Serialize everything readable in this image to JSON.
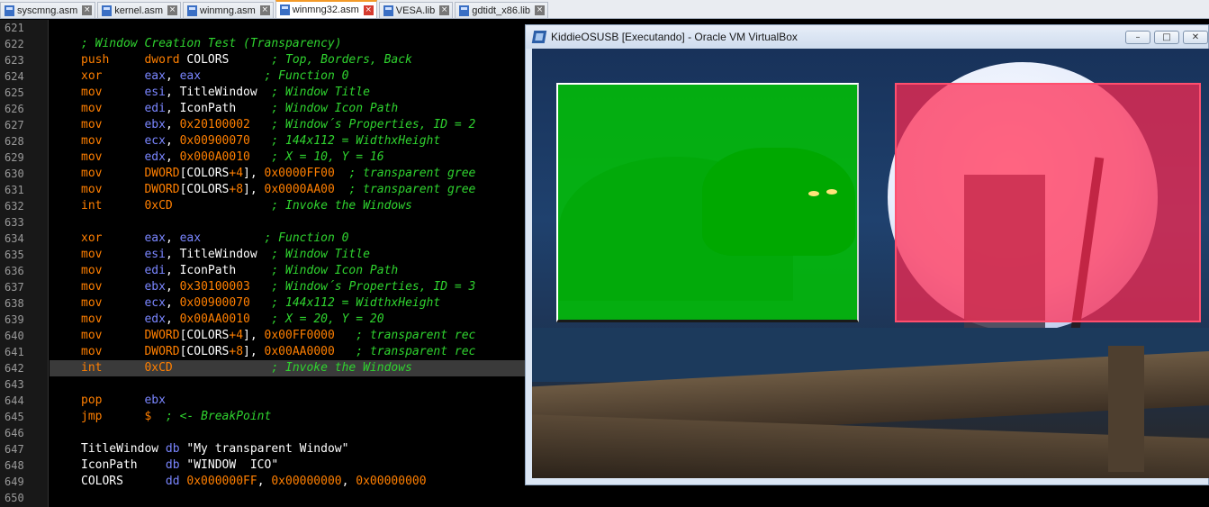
{
  "tabs": [
    {
      "label": "syscmng.asm",
      "active": false
    },
    {
      "label": "kernel.asm",
      "active": false
    },
    {
      "label": "winmng.asm",
      "active": false
    },
    {
      "label": "winmng32.asm",
      "active": true
    },
    {
      "label": "VESA.lib",
      "active": false
    },
    {
      "label": "gdtidt_x86.lib",
      "active": false
    }
  ],
  "editor": {
    "highlighted_line": "642",
    "lines": [
      {
        "n": "621",
        "tokens": []
      },
      {
        "n": "622",
        "tokens": [
          {
            "t": "; Window Creation Test (Transparency)",
            "c": "cmt"
          }
        ]
      },
      {
        "n": "623",
        "tokens": [
          {
            "t": "push",
            "c": "kw"
          },
          {
            "t": "     ",
            "c": "id"
          },
          {
            "t": "dword",
            "c": "kw"
          },
          {
            "t": " COLORS      ",
            "c": "id"
          },
          {
            "t": "; Top, Borders, Back",
            "c": "cmt"
          }
        ]
      },
      {
        "n": "624",
        "tokens": [
          {
            "t": "xor",
            "c": "kw"
          },
          {
            "t": "      ",
            "c": "id"
          },
          {
            "t": "eax",
            "c": "reg"
          },
          {
            "t": ", ",
            "c": "id"
          },
          {
            "t": "eax",
            "c": "reg"
          },
          {
            "t": "         ",
            "c": "id"
          },
          {
            "t": "; Function 0",
            "c": "cmt"
          }
        ]
      },
      {
        "n": "625",
        "tokens": [
          {
            "t": "mov",
            "c": "kw"
          },
          {
            "t": "      ",
            "c": "id"
          },
          {
            "t": "esi",
            "c": "reg"
          },
          {
            "t": ", TitleWindow  ",
            "c": "id"
          },
          {
            "t": "; Window Title",
            "c": "cmt"
          }
        ]
      },
      {
        "n": "626",
        "tokens": [
          {
            "t": "mov",
            "c": "kw"
          },
          {
            "t": "      ",
            "c": "id"
          },
          {
            "t": "edi",
            "c": "reg"
          },
          {
            "t": ", IconPath     ",
            "c": "id"
          },
          {
            "t": "; Window Icon Path",
            "c": "cmt"
          }
        ]
      },
      {
        "n": "627",
        "tokens": [
          {
            "t": "mov",
            "c": "kw"
          },
          {
            "t": "      ",
            "c": "id"
          },
          {
            "t": "ebx",
            "c": "reg"
          },
          {
            "t": ", ",
            "c": "id"
          },
          {
            "t": "0x20100002",
            "c": "num"
          },
          {
            "t": "   ",
            "c": "id"
          },
          {
            "t": "; Window´s Properties, ID = 2",
            "c": "cmt"
          }
        ]
      },
      {
        "n": "628",
        "tokens": [
          {
            "t": "mov",
            "c": "kw"
          },
          {
            "t": "      ",
            "c": "id"
          },
          {
            "t": "ecx",
            "c": "reg"
          },
          {
            "t": ", ",
            "c": "id"
          },
          {
            "t": "0x00900070",
            "c": "num"
          },
          {
            "t": "   ",
            "c": "id"
          },
          {
            "t": "; 144x112 = WidthxHeight",
            "c": "cmt"
          }
        ]
      },
      {
        "n": "629",
        "tokens": [
          {
            "t": "mov",
            "c": "kw"
          },
          {
            "t": "      ",
            "c": "id"
          },
          {
            "t": "edx",
            "c": "reg"
          },
          {
            "t": ", ",
            "c": "id"
          },
          {
            "t": "0x000A0010",
            "c": "num"
          },
          {
            "t": "   ",
            "c": "id"
          },
          {
            "t": "; X = 10, Y = 16",
            "c": "cmt"
          }
        ]
      },
      {
        "n": "630",
        "tokens": [
          {
            "t": "mov",
            "c": "kw"
          },
          {
            "t": "      ",
            "c": "id"
          },
          {
            "t": "DWORD",
            "c": "kw"
          },
          {
            "t": "[COLORS",
            "c": "id"
          },
          {
            "t": "+4",
            "c": "sym"
          },
          {
            "t": "], ",
            "c": "id"
          },
          {
            "t": "0x0000FF00",
            "c": "num"
          },
          {
            "t": "  ",
            "c": "id"
          },
          {
            "t": "; transparent gree",
            "c": "cmt"
          }
        ]
      },
      {
        "n": "631",
        "tokens": [
          {
            "t": "mov",
            "c": "kw"
          },
          {
            "t": "      ",
            "c": "id"
          },
          {
            "t": "DWORD",
            "c": "kw"
          },
          {
            "t": "[COLORS",
            "c": "id"
          },
          {
            "t": "+8",
            "c": "sym"
          },
          {
            "t": "], ",
            "c": "id"
          },
          {
            "t": "0x0000AA00",
            "c": "num"
          },
          {
            "t": "  ",
            "c": "id"
          },
          {
            "t": "; transparent gree",
            "c": "cmt"
          }
        ]
      },
      {
        "n": "632",
        "tokens": [
          {
            "t": "int",
            "c": "kw"
          },
          {
            "t": "      ",
            "c": "id"
          },
          {
            "t": "0xCD",
            "c": "num"
          },
          {
            "t": "              ",
            "c": "id"
          },
          {
            "t": "; Invoke the Windows",
            "c": "cmt"
          }
        ]
      },
      {
        "n": "633",
        "tokens": []
      },
      {
        "n": "634",
        "tokens": [
          {
            "t": "xor",
            "c": "kw"
          },
          {
            "t": "      ",
            "c": "id"
          },
          {
            "t": "eax",
            "c": "reg"
          },
          {
            "t": ", ",
            "c": "id"
          },
          {
            "t": "eax",
            "c": "reg"
          },
          {
            "t": "         ",
            "c": "id"
          },
          {
            "t": "; Function 0",
            "c": "cmt"
          }
        ]
      },
      {
        "n": "635",
        "tokens": [
          {
            "t": "mov",
            "c": "kw"
          },
          {
            "t": "      ",
            "c": "id"
          },
          {
            "t": "esi",
            "c": "reg"
          },
          {
            "t": ", TitleWindow  ",
            "c": "id"
          },
          {
            "t": "; Window Title",
            "c": "cmt"
          }
        ]
      },
      {
        "n": "636",
        "tokens": [
          {
            "t": "mov",
            "c": "kw"
          },
          {
            "t": "      ",
            "c": "id"
          },
          {
            "t": "edi",
            "c": "reg"
          },
          {
            "t": ", IconPath     ",
            "c": "id"
          },
          {
            "t": "; Window Icon Path",
            "c": "cmt"
          }
        ]
      },
      {
        "n": "637",
        "tokens": [
          {
            "t": "mov",
            "c": "kw"
          },
          {
            "t": "      ",
            "c": "id"
          },
          {
            "t": "ebx",
            "c": "reg"
          },
          {
            "t": ", ",
            "c": "id"
          },
          {
            "t": "0x30100003",
            "c": "num"
          },
          {
            "t": "   ",
            "c": "id"
          },
          {
            "t": "; Window´s Properties, ID = 3",
            "c": "cmt"
          }
        ]
      },
      {
        "n": "638",
        "tokens": [
          {
            "t": "mov",
            "c": "kw"
          },
          {
            "t": "      ",
            "c": "id"
          },
          {
            "t": "ecx",
            "c": "reg"
          },
          {
            "t": ", ",
            "c": "id"
          },
          {
            "t": "0x00900070",
            "c": "num"
          },
          {
            "t": "   ",
            "c": "id"
          },
          {
            "t": "; 144x112 = WidthxHeight",
            "c": "cmt"
          }
        ]
      },
      {
        "n": "639",
        "tokens": [
          {
            "t": "mov",
            "c": "kw"
          },
          {
            "t": "      ",
            "c": "id"
          },
          {
            "t": "edx",
            "c": "reg"
          },
          {
            "t": ", ",
            "c": "id"
          },
          {
            "t": "0x00AA0010",
            "c": "num"
          },
          {
            "t": "   ",
            "c": "id"
          },
          {
            "t": "; X = 20, Y = 20",
            "c": "cmt"
          }
        ]
      },
      {
        "n": "640",
        "tokens": [
          {
            "t": "mov",
            "c": "kw"
          },
          {
            "t": "      ",
            "c": "id"
          },
          {
            "t": "DWORD",
            "c": "kw"
          },
          {
            "t": "[COLORS",
            "c": "id"
          },
          {
            "t": "+4",
            "c": "sym"
          },
          {
            "t": "], ",
            "c": "id"
          },
          {
            "t": "0x00FF0000",
            "c": "num"
          },
          {
            "t": "   ",
            "c": "id"
          },
          {
            "t": "; transparent rec",
            "c": "cmt"
          }
        ]
      },
      {
        "n": "641",
        "tokens": [
          {
            "t": "mov",
            "c": "kw"
          },
          {
            "t": "      ",
            "c": "id"
          },
          {
            "t": "DWORD",
            "c": "kw"
          },
          {
            "t": "[COLORS",
            "c": "id"
          },
          {
            "t": "+8",
            "c": "sym"
          },
          {
            "t": "], ",
            "c": "id"
          },
          {
            "t": "0x00AA0000",
            "c": "num"
          },
          {
            "t": "   ",
            "c": "id"
          },
          {
            "t": "; transparent rec",
            "c": "cmt"
          }
        ]
      },
      {
        "n": "642",
        "tokens": [
          {
            "t": "int",
            "c": "kw"
          },
          {
            "t": "      ",
            "c": "id"
          },
          {
            "t": "0xCD",
            "c": "num"
          },
          {
            "t": "              ",
            "c": "id"
          },
          {
            "t": "; Invoke the Windows",
            "c": "cmt"
          }
        ]
      },
      {
        "n": "643",
        "tokens": []
      },
      {
        "n": "644",
        "tokens": [
          {
            "t": "pop",
            "c": "kw"
          },
          {
            "t": "      ",
            "c": "id"
          },
          {
            "t": "ebx",
            "c": "reg"
          }
        ]
      },
      {
        "n": "645",
        "tokens": [
          {
            "t": "jmp",
            "c": "kw"
          },
          {
            "t": "      ",
            "c": "id"
          },
          {
            "t": "$",
            "c": "sym"
          },
          {
            "t": "  ",
            "c": "id"
          },
          {
            "t": "; <- BreakPoint",
            "c": "cmt"
          }
        ]
      },
      {
        "n": "646",
        "tokens": []
      },
      {
        "n": "647",
        "tokens": [
          {
            "t": "TitleWindow ",
            "c": "id"
          },
          {
            "t": "db",
            "c": "dir"
          },
          {
            "t": " \"My transparent Window\"",
            "c": "str"
          }
        ]
      },
      {
        "n": "648",
        "tokens": [
          {
            "t": "IconPath    ",
            "c": "id"
          },
          {
            "t": "db",
            "c": "dir"
          },
          {
            "t": " \"WINDOW  ICO\"",
            "c": "str"
          }
        ]
      },
      {
        "n": "649",
        "tokens": [
          {
            "t": "COLORS      ",
            "c": "id"
          },
          {
            "t": "dd",
            "c": "dir"
          },
          {
            "t": " ",
            "c": "id"
          },
          {
            "t": "0x000000FF",
            "c": "num"
          },
          {
            "t": ", ",
            "c": "id"
          },
          {
            "t": "0x00000000",
            "c": "num"
          },
          {
            "t": ", ",
            "c": "id"
          },
          {
            "t": "0x00000000",
            "c": "num"
          }
        ]
      },
      {
        "n": "650",
        "tokens": []
      }
    ]
  },
  "vbox": {
    "title": "KiddieOSUSB [Executando] - Oracle VM VirtualBox",
    "minimize_glyph": "–",
    "restore_glyph": "□",
    "close_glyph": "✕"
  },
  "colors": {
    "accent": "#f39a28",
    "green_window": "#00c800",
    "red_window": "#ff2850"
  }
}
